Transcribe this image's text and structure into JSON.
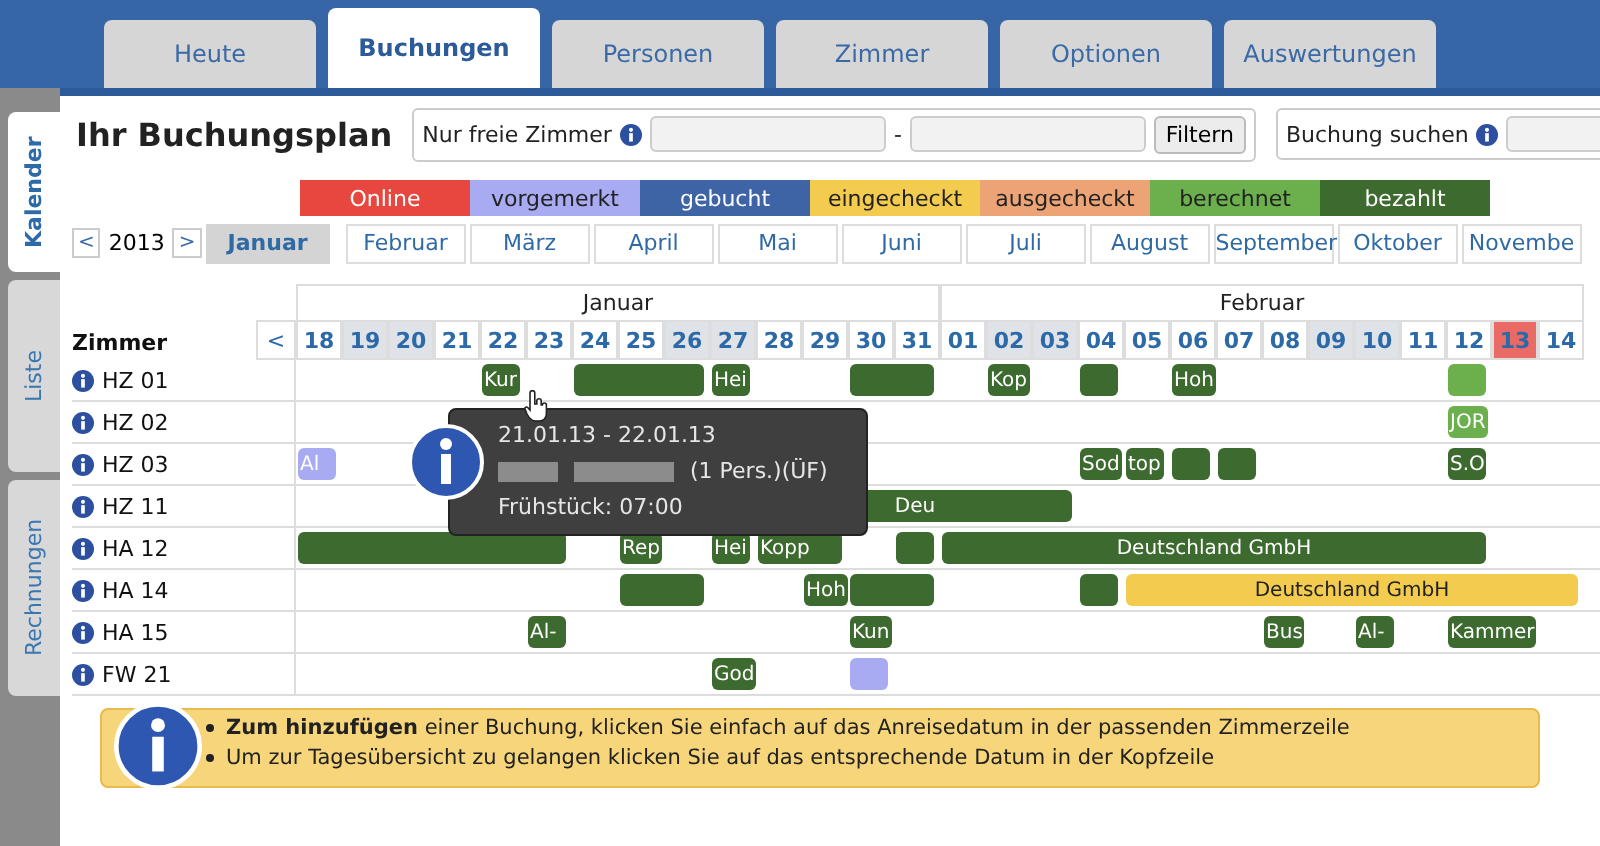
{
  "tabs": [
    {
      "label": "Heute",
      "selected": false
    },
    {
      "label": "Buchungen",
      "selected": true
    },
    {
      "label": "Personen",
      "selected": false
    },
    {
      "label": "Zimmer",
      "selected": false
    },
    {
      "label": "Optionen",
      "selected": false
    },
    {
      "label": "Auswertungen",
      "selected": false
    }
  ],
  "side_tabs": [
    {
      "label": "Kalender",
      "selected": true
    },
    {
      "label": "Liste",
      "selected": false
    },
    {
      "label": "Rechnungen",
      "selected": false
    }
  ],
  "title": "Ihr Buchungsplan",
  "filter": {
    "label": "Nur freie Zimmer",
    "separator": "-",
    "button": "Filtern"
  },
  "search": {
    "label": "Buchung suchen"
  },
  "legend": [
    {
      "label": "Online",
      "color": "#e8473f"
    },
    {
      "label": "vorgemerkt",
      "color": "#a9abf2"
    },
    {
      "label": "gebucht",
      "color": "#3f64a6"
    },
    {
      "label": "eingecheckt",
      "color": "#f3cb4e"
    },
    {
      "label": "ausgecheckt",
      "color": "#eca476"
    },
    {
      "label": "berechnet",
      "color": "#6cb04e"
    },
    {
      "label": "bezahlt",
      "color": "#3d6a2e"
    }
  ],
  "year_nav": {
    "prev": "<",
    "year": "2013",
    "next": ">"
  },
  "months": [
    {
      "label": "Januar",
      "selected": true
    },
    {
      "label": "Februar",
      "selected": false
    },
    {
      "label": "März",
      "selected": false
    },
    {
      "label": "April",
      "selected": false
    },
    {
      "label": "Mai",
      "selected": false
    },
    {
      "label": "Juni",
      "selected": false
    },
    {
      "label": "Juli",
      "selected": false
    },
    {
      "label": "August",
      "selected": false
    },
    {
      "label": "September",
      "selected": false
    },
    {
      "label": "Oktober",
      "selected": false
    },
    {
      "label": "Novembe",
      "selected": false
    }
  ],
  "calendar": {
    "room_header": "Zimmer",
    "prev": "<",
    "months": [
      {
        "label": "Januar",
        "days": [
          {
            "label": "18",
            "weekend": false,
            "today": false
          },
          {
            "label": "19",
            "weekend": true,
            "today": false
          },
          {
            "label": "20",
            "weekend": true,
            "today": false
          },
          {
            "label": "21",
            "weekend": false,
            "today": false
          },
          {
            "label": "22",
            "weekend": false,
            "today": false
          },
          {
            "label": "23",
            "weekend": false,
            "today": false
          },
          {
            "label": "24",
            "weekend": false,
            "today": false
          },
          {
            "label": "25",
            "weekend": false,
            "today": false
          },
          {
            "label": "26",
            "weekend": true,
            "today": false
          },
          {
            "label": "27",
            "weekend": true,
            "today": false
          },
          {
            "label": "28",
            "weekend": false,
            "today": false
          },
          {
            "label": "29",
            "weekend": false,
            "today": false
          },
          {
            "label": "30",
            "weekend": false,
            "today": false
          },
          {
            "label": "31",
            "weekend": false,
            "today": false
          }
        ]
      },
      {
        "label": "Februar",
        "days": [
          {
            "label": "01",
            "weekend": false,
            "today": false
          },
          {
            "label": "02",
            "weekend": true,
            "today": false
          },
          {
            "label": "03",
            "weekend": true,
            "today": false
          },
          {
            "label": "04",
            "weekend": false,
            "today": false
          },
          {
            "label": "05",
            "weekend": false,
            "today": false
          },
          {
            "label": "06",
            "weekend": false,
            "today": false
          },
          {
            "label": "07",
            "weekend": false,
            "today": false
          },
          {
            "label": "08",
            "weekend": false,
            "today": false
          },
          {
            "label": "09",
            "weekend": true,
            "today": false
          },
          {
            "label": "10",
            "weekend": true,
            "today": false
          },
          {
            "label": "11",
            "weekend": false,
            "today": false
          },
          {
            "label": "12",
            "weekend": false,
            "today": false
          },
          {
            "label": "13",
            "weekend": false,
            "today": true
          },
          {
            "label": "14",
            "weekend": false,
            "today": false
          }
        ]
      }
    ]
  },
  "rooms": [
    {
      "name": "HZ 01",
      "slots": [
        {
          "kind": "free"
        },
        {
          "kind": "free"
        },
        {
          "kind": "free"
        },
        {
          "kind": "free"
        },
        {
          "kind": "booking",
          "color": "#3d6a2e",
          "text": "Kur"
        },
        {
          "kind": "free"
        },
        {
          "kind": "booking",
          "color": "#3d6a2e"
        },
        {
          "kind": "cont"
        },
        {
          "kind": "cont"
        },
        {
          "kind": "booking",
          "color": "#3d6a2e",
          "text": "Hei"
        },
        {
          "kind": "free"
        },
        {
          "kind": "free"
        },
        {
          "kind": "booking",
          "color": "#3d6a2e"
        },
        {
          "kind": "cont"
        },
        {
          "kind": "free"
        },
        {
          "kind": "booking",
          "color": "#3d6a2e",
          "text": "Kop"
        },
        {
          "kind": "free"
        },
        {
          "kind": "booking",
          "color": "#3d6a2e"
        },
        {
          "kind": "free"
        },
        {
          "kind": "booking",
          "color": "#3d6a2e",
          "text": "Hoh"
        },
        {
          "kind": "free"
        },
        {
          "kind": "free"
        },
        {
          "kind": "free"
        },
        {
          "kind": "free"
        },
        {
          "kind": "free"
        },
        {
          "kind": "booking",
          "color": "#6cb04e"
        },
        {
          "kind": "free"
        },
        {
          "kind": "free"
        }
      ]
    },
    {
      "name": "HZ 02",
      "slots": [
        {
          "kind": "free"
        },
        {
          "kind": "free"
        },
        {
          "kind": "free"
        },
        {
          "kind": "free"
        },
        {
          "kind": "free"
        },
        {
          "kind": "free"
        },
        {
          "kind": "free"
        },
        {
          "kind": "free"
        },
        {
          "kind": "free"
        },
        {
          "kind": "free"
        },
        {
          "kind": "free"
        },
        {
          "kind": "free"
        },
        {
          "kind": "free"
        },
        {
          "kind": "free"
        },
        {
          "kind": "free"
        },
        {
          "kind": "free"
        },
        {
          "kind": "free"
        },
        {
          "kind": "free"
        },
        {
          "kind": "free"
        },
        {
          "kind": "free"
        },
        {
          "kind": "free"
        },
        {
          "kind": "free"
        },
        {
          "kind": "free"
        },
        {
          "kind": "free"
        },
        {
          "kind": "free"
        },
        {
          "kind": "booking",
          "color": "#6cb04e",
          "text": "JOR"
        },
        {
          "kind": "free"
        },
        {
          "kind": "free"
        }
      ]
    },
    {
      "name": "HZ 03",
      "slots": [
        {
          "kind": "booking",
          "color": "#a9abf2",
          "text": "Al"
        },
        {
          "kind": "free"
        },
        {
          "kind": "free"
        },
        {
          "kind": "free"
        },
        {
          "kind": "free"
        },
        {
          "kind": "free"
        },
        {
          "kind": "free"
        },
        {
          "kind": "free"
        },
        {
          "kind": "free"
        },
        {
          "kind": "free"
        },
        {
          "kind": "free"
        },
        {
          "kind": "free"
        },
        {
          "kind": "free"
        },
        {
          "kind": "free"
        },
        {
          "kind": "free"
        },
        {
          "kind": "free"
        },
        {
          "kind": "free"
        },
        {
          "kind": "booking",
          "color": "#3d6a2e",
          "text": "Sod"
        },
        {
          "kind": "booking",
          "color": "#3d6a2e",
          "text": "top"
        },
        {
          "kind": "booking",
          "color": "#3d6a2e"
        },
        {
          "kind": "booking",
          "color": "#3d6a2e"
        },
        {
          "kind": "free"
        },
        {
          "kind": "free"
        },
        {
          "kind": "free"
        },
        {
          "kind": "free"
        },
        {
          "kind": "booking",
          "color": "#3d6a2e",
          "text": "S.O"
        },
        {
          "kind": "free"
        },
        {
          "kind": "free"
        }
      ]
    },
    {
      "name": "HZ 11",
      "slots": [
        {
          "kind": "free"
        },
        {
          "kind": "free"
        },
        {
          "kind": "free"
        },
        {
          "kind": "free"
        },
        {
          "kind": "free"
        },
        {
          "kind": "free"
        },
        {
          "kind": "free"
        },
        {
          "kind": "free"
        },
        {
          "kind": "free"
        },
        {
          "kind": "free"
        },
        {
          "kind": "booking",
          "color": "#3d6a2e",
          "text": "Deu"
        },
        {
          "kind": "cont"
        },
        {
          "kind": "cont"
        },
        {
          "kind": "cont"
        },
        {
          "kind": "cont"
        },
        {
          "kind": "cont"
        },
        {
          "kind": "cont"
        },
        {
          "kind": "free"
        },
        {
          "kind": "free"
        },
        {
          "kind": "free"
        },
        {
          "kind": "free"
        },
        {
          "kind": "free"
        },
        {
          "kind": "free"
        },
        {
          "kind": "free"
        },
        {
          "kind": "free"
        },
        {
          "kind": "free"
        },
        {
          "kind": "free"
        },
        {
          "kind": "free"
        }
      ]
    },
    {
      "name": "HA 12",
      "slots": [
        {
          "kind": "booking",
          "color": "#3d6a2e"
        },
        {
          "kind": "cont"
        },
        {
          "kind": "cont"
        },
        {
          "kind": "cont"
        },
        {
          "kind": "cont"
        },
        {
          "kind": "cont"
        },
        {
          "kind": "free"
        },
        {
          "kind": "booking",
          "color": "#3d6a2e",
          "text": "Rep"
        },
        {
          "kind": "free"
        },
        {
          "kind": "booking",
          "color": "#3d6a2e",
          "text": "Hei"
        },
        {
          "kind": "booking",
          "color": "#3d6a2e",
          "text": "Kopp"
        },
        {
          "kind": "cont"
        },
        {
          "kind": "free"
        },
        {
          "kind": "booking",
          "color": "#3d6a2e"
        },
        {
          "kind": "booking",
          "color": "#3d6a2e",
          "text": "Deutschland GmbH"
        },
        {
          "kind": "cont"
        },
        {
          "kind": "cont"
        },
        {
          "kind": "cont"
        },
        {
          "kind": "cont"
        },
        {
          "kind": "cont"
        },
        {
          "kind": "cont"
        },
        {
          "kind": "cont"
        },
        {
          "kind": "cont"
        },
        {
          "kind": "cont"
        },
        {
          "kind": "cont"
        },
        {
          "kind": "cont"
        },
        {
          "kind": "free"
        },
        {
          "kind": "free"
        }
      ]
    },
    {
      "name": "HA 14",
      "slots": [
        {
          "kind": "free"
        },
        {
          "kind": "free"
        },
        {
          "kind": "free"
        },
        {
          "kind": "free"
        },
        {
          "kind": "free"
        },
        {
          "kind": "free"
        },
        {
          "kind": "free"
        },
        {
          "kind": "booking",
          "color": "#3d6a2e"
        },
        {
          "kind": "cont"
        },
        {
          "kind": "free"
        },
        {
          "kind": "free"
        },
        {
          "kind": "booking",
          "color": "#3d6a2e",
          "text": "Hoh"
        },
        {
          "kind": "booking",
          "color": "#3d6a2e"
        },
        {
          "kind": "cont"
        },
        {
          "kind": "free"
        },
        {
          "kind": "free"
        },
        {
          "kind": "free"
        },
        {
          "kind": "booking",
          "color": "#3d6a2e"
        },
        {
          "kind": "booking",
          "color": "#f3cb4e",
          "text": "Deutschland GmbH"
        },
        {
          "kind": "cont"
        },
        {
          "kind": "cont"
        },
        {
          "kind": "cont"
        },
        {
          "kind": "cont"
        },
        {
          "kind": "cont"
        },
        {
          "kind": "cont"
        },
        {
          "kind": "cont"
        },
        {
          "kind": "cont"
        },
        {
          "kind": "cont"
        }
      ]
    },
    {
      "name": "HA 15",
      "slots": [
        {
          "kind": "free"
        },
        {
          "kind": "free"
        },
        {
          "kind": "free"
        },
        {
          "kind": "free"
        },
        {
          "kind": "free"
        },
        {
          "kind": "booking",
          "color": "#3d6a2e",
          "text": "Al-"
        },
        {
          "kind": "free"
        },
        {
          "kind": "free"
        },
        {
          "kind": "free"
        },
        {
          "kind": "free"
        },
        {
          "kind": "free"
        },
        {
          "kind": "free"
        },
        {
          "kind": "booking",
          "color": "#3d6a2e",
          "text": "Kun"
        },
        {
          "kind": "free"
        },
        {
          "kind": "free"
        },
        {
          "kind": "free"
        },
        {
          "kind": "free"
        },
        {
          "kind": "free"
        },
        {
          "kind": "free"
        },
        {
          "kind": "free"
        },
        {
          "kind": "free"
        },
        {
          "kind": "booking",
          "color": "#3d6a2e",
          "text": "Bus"
        },
        {
          "kind": "free"
        },
        {
          "kind": "booking",
          "color": "#3d6a2e",
          "text": "Al-"
        },
        {
          "kind": "free"
        },
        {
          "kind": "booking",
          "color": "#3d6a2e",
          "text": "Kammer"
        },
        {
          "kind": "cont"
        },
        {
          "kind": "free"
        }
      ]
    },
    {
      "name": "FW 21",
      "slots": [
        {
          "kind": "free"
        },
        {
          "kind": "free"
        },
        {
          "kind": "free"
        },
        {
          "kind": "free"
        },
        {
          "kind": "free"
        },
        {
          "kind": "free"
        },
        {
          "kind": "free"
        },
        {
          "kind": "free"
        },
        {
          "kind": "free"
        },
        {
          "kind": "booking",
          "color": "#3d6a2e",
          "text": "God"
        },
        {
          "kind": "free"
        },
        {
          "kind": "free"
        },
        {
          "kind": "booking",
          "color": "#a9abf2"
        },
        {
          "kind": "free"
        },
        {
          "kind": "free"
        },
        {
          "kind": "free"
        },
        {
          "kind": "free"
        },
        {
          "kind": "free"
        },
        {
          "kind": "free"
        },
        {
          "kind": "free"
        },
        {
          "kind": "free"
        },
        {
          "kind": "free"
        },
        {
          "kind": "free"
        },
        {
          "kind": "free"
        },
        {
          "kind": "free"
        },
        {
          "kind": "free"
        },
        {
          "kind": "free"
        },
        {
          "kind": "free"
        }
      ]
    }
  ],
  "tooltip": {
    "dates": "21.01.13 - 22.01.13",
    "guests": "(1 Pers.)(ÜF)",
    "breakfast": "Frühstück: 07:00"
  },
  "hints": [
    "**Zum hinzufügen** einer Buchung, klicken Sie einfach auf das Anreisedatum in der passenden Zimmerzeile",
    "Um zur Tagesübersicht zu gelangen klicken Sie auf das entsprechende Datum in der Kopfzeile"
  ]
}
